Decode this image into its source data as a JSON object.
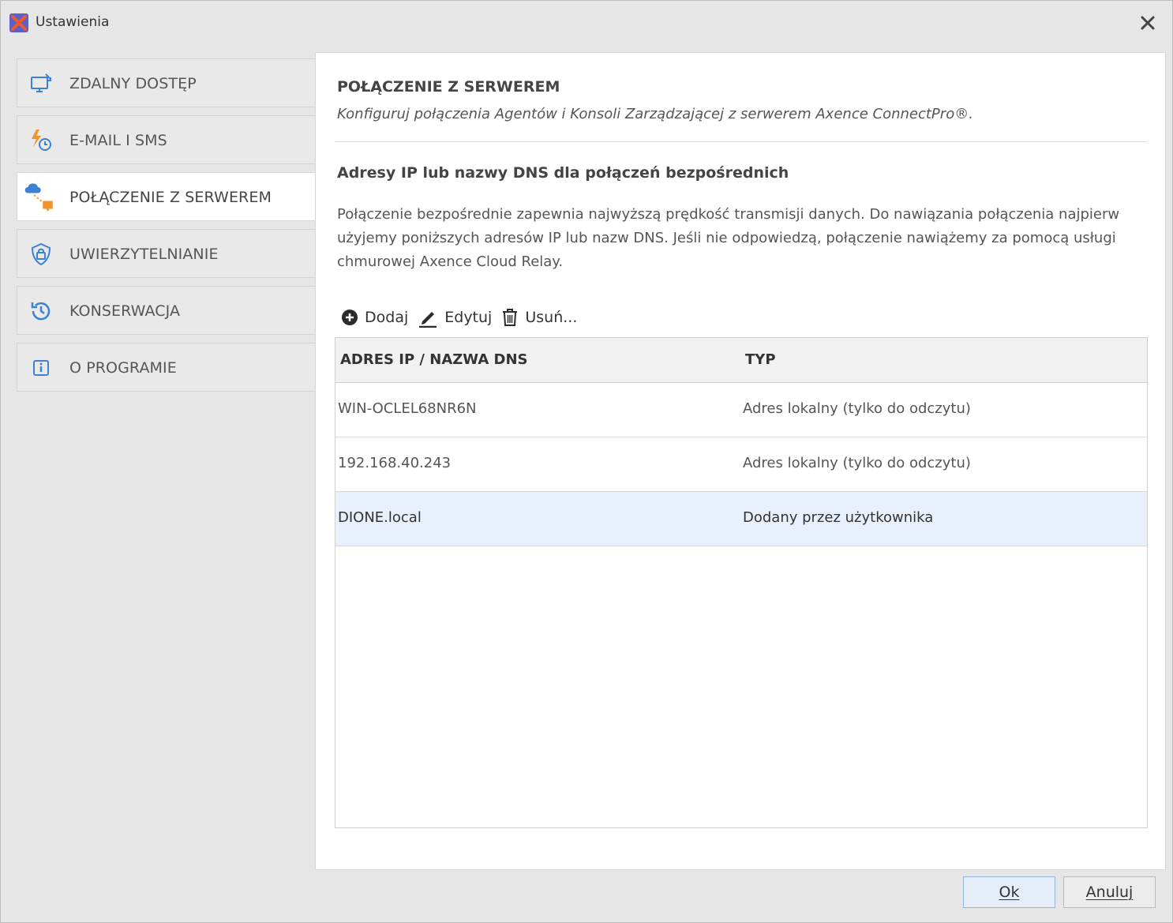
{
  "window": {
    "title": "Ustawienia"
  },
  "sidebar": {
    "items": [
      {
        "label": "ZDALNY DOSTĘP",
        "icon": "remote-monitor-icon"
      },
      {
        "label": "E-MAIL I SMS",
        "icon": "alert-clock-icon"
      },
      {
        "label": "POŁĄCZENIE Z SERWEREM",
        "icon": "cloud-server-icon",
        "active": true
      },
      {
        "label": "UWIERZYTELNIANIE",
        "icon": "lock-shield-icon"
      },
      {
        "label": "KONSERWACJA",
        "icon": "history-icon"
      },
      {
        "label": "O PROGRAMIE",
        "icon": "info-icon"
      }
    ]
  },
  "panel": {
    "title": "POŁĄCZENIE Z SERWEREM",
    "subtitle": "Konfiguruj połączenia Agentów i Konsoli Zarządzającej z serwerem Axence ConnectPro®.",
    "section_title": "Adresy IP lub nazwy DNS dla połączeń bezpośrednich",
    "section_desc": "Połączenie bezpośrednie zapewnia najwyższą prędkość transmisji danych. Do nawiązania połączenia najpierw użyjemy poniższych adresów IP lub nazw DNS. Jeśli nie odpowiedzą, połączenie nawiążemy za pomocą usługi chmurowej Axence Cloud Relay."
  },
  "toolbar": {
    "add_label": "Dodaj",
    "edit_label": "Edytuj",
    "delete_label": "Usuń..."
  },
  "table": {
    "headers": {
      "address": "ADRES IP / NAZWA DNS",
      "type": "TYP"
    },
    "rows": [
      {
        "address": "WIN-OCLEL68NR6N",
        "type": "Adres lokalny (tylko do odczytu)"
      },
      {
        "address": "192.168.40.243",
        "type": "Adres lokalny (tylko do odczytu)"
      },
      {
        "address": "DIONE.local",
        "type": "Dodany przez użytkownika",
        "selected": true
      }
    ]
  },
  "footer": {
    "ok_label": "Ok",
    "cancel_label": "Anuluj"
  },
  "colors": {
    "accent_blue": "#3b82d6",
    "accent_orange": "#f0932b",
    "selected_row": "#e8f0fb"
  }
}
